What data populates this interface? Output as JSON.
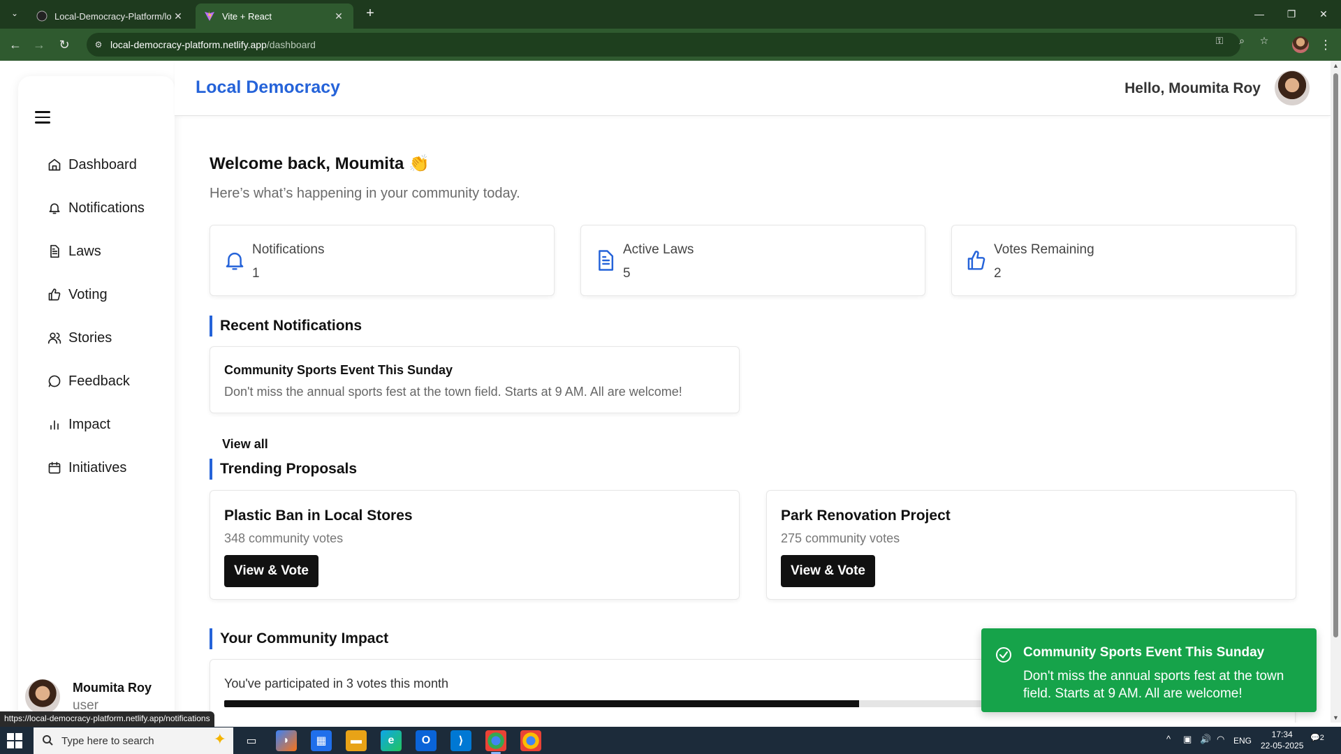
{
  "browser": {
    "tabs": [
      {
        "title": "Local-Democracy-Platform/loc",
        "active": false
      },
      {
        "title": "Vite + React",
        "active": true
      }
    ],
    "url_host": "local-democracy-platform.netlify.app",
    "url_path": "/dashboard",
    "new_tab_symbol": "+",
    "tab_close_symbol": "✕",
    "window_controls": {
      "minimize": "—",
      "restore": "❐",
      "close": "✕"
    }
  },
  "app": {
    "brand": "Local Democracy",
    "greeting": "Hello, Moumita Roy",
    "accent_color": "#2563d9"
  },
  "sidebar": {
    "items": [
      {
        "label": "Dashboard",
        "icon": "home-icon"
      },
      {
        "label": "Notifications",
        "icon": "bell-icon"
      },
      {
        "label": "Laws",
        "icon": "document-icon"
      },
      {
        "label": "Voting",
        "icon": "thumbs-up-icon"
      },
      {
        "label": "Stories",
        "icon": "users-icon"
      },
      {
        "label": "Feedback",
        "icon": "chat-icon"
      },
      {
        "label": "Impact",
        "icon": "bar-chart-icon"
      },
      {
        "label": "Initiatives",
        "icon": "calendar-icon"
      }
    ],
    "user": {
      "name": "Moumita Roy",
      "role": "user"
    }
  },
  "main": {
    "welcome": "Welcome back, Moumita 👏",
    "subtitle": "Here’s what’s happening in your community today.",
    "stats": [
      {
        "label": "Notifications",
        "value": "1",
        "icon": "bell-icon"
      },
      {
        "label": "Active Laws",
        "value": "5",
        "icon": "document-icon"
      },
      {
        "label": "Votes Remaining",
        "value": "2",
        "icon": "thumbs-up-icon"
      }
    ],
    "recent_notifications_title": "Recent Notifications",
    "notification": {
      "title": "Community Sports Event This Sunday",
      "message": "Don't miss the annual sports fest at the town field. Starts at 9 AM. All are welcome!"
    },
    "view_all": "View all",
    "trending_title": "Trending Proposals",
    "proposals": [
      {
        "title": "Plastic Ban in Local Stores",
        "votes": "348 community votes",
        "button": "View & Vote"
      },
      {
        "title": "Park Renovation Project",
        "votes": "275 community votes",
        "button": "View & Vote"
      }
    ],
    "impact_title": "Your Community Impact",
    "impact_text": "You've participated in 3 votes this month",
    "impact_progress": 0.6
  },
  "toast": {
    "title": "Community Sports Event This Sunday",
    "message": "Don't miss the annual sports fest at the town field. Starts at 9 AM. All are welcome!",
    "color": "#16a34a"
  },
  "status_link": "https://local-democracy-platform.netlify.app/notifications",
  "taskbar": {
    "search_placeholder": "Type here to search",
    "language": "ENG",
    "time": "17:34",
    "date": "22-05-2025",
    "notification_count": "2"
  }
}
